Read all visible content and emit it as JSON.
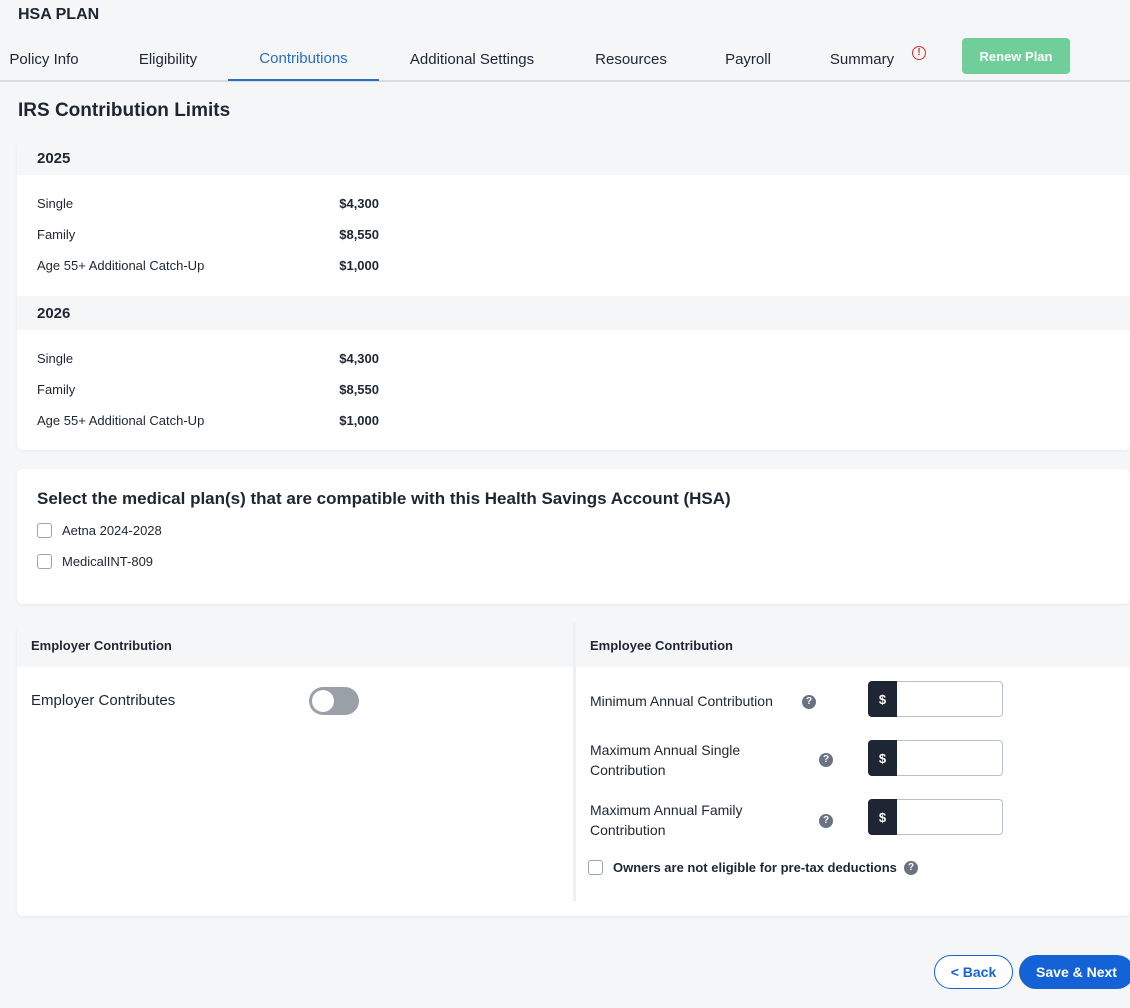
{
  "app": {
    "title": "HSA PLAN"
  },
  "tabs": [
    {
      "label": "Policy Info"
    },
    {
      "label": "Eligibility"
    },
    {
      "label": "Contributions"
    },
    {
      "label": "Additional Settings"
    },
    {
      "label": "Resources"
    },
    {
      "label": "Payroll"
    },
    {
      "label": "Summary"
    }
  ],
  "alert_icon": {
    "glyph": "!",
    "color": "#d32f2f"
  },
  "renew_label": "Renew Plan",
  "irs": {
    "title": "IRS Contribution Limits",
    "years": [
      {
        "year": "2025",
        "rows": [
          {
            "label": "Single",
            "value": "$4,300"
          },
          {
            "label": "Family",
            "value": "$8,550"
          },
          {
            "label": "Age 55+ Additional Catch-Up",
            "value": "$1,000"
          }
        ]
      },
      {
        "year": "2026",
        "rows": [
          {
            "label": "Single",
            "value": "$4,300"
          },
          {
            "label": "Family",
            "value": "$8,550"
          },
          {
            "label": "Age 55+ Additional Catch-Up",
            "value": "$1,000"
          }
        ]
      }
    ]
  },
  "plans": {
    "title": "Select the medical plan(s) that are compatible with this Health Savings Account (HSA)",
    "options": [
      {
        "label": "Aetna 2024-2028",
        "checked": false
      },
      {
        "label": "MedicalINT-809",
        "checked": false
      }
    ]
  },
  "employer": {
    "header": "Employer Contribution",
    "toggle_label": "Employer Contributes",
    "toggle_on": false
  },
  "employee": {
    "header": "Employee Contribution",
    "currency_symbol": "$",
    "help_glyph": "?",
    "fields": [
      {
        "label": "Minimum Annual Contribution",
        "value": ""
      },
      {
        "label": "Maximum Annual Single\nContribution",
        "value": ""
      },
      {
        "label": "Maximum Annual Family\nContribution",
        "value": ""
      }
    ],
    "owners_label": "Owners are not eligible for pre-tax deductions",
    "owners_checked": false
  },
  "footer": {
    "back_label": "< Back",
    "save_label": "Save & Next"
  },
  "colors": {
    "accent": "#2a6fbd",
    "primary_button": "#1463d6",
    "renew_button": "#6fce9a",
    "alert": "#d32f2f"
  }
}
